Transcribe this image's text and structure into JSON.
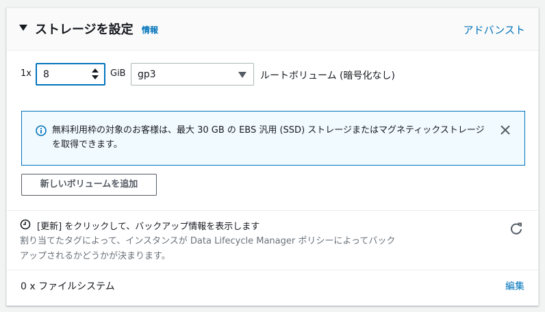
{
  "header": {
    "title": "ストレージを設定",
    "info_link": "情報",
    "advanced_link": "アドバンスト"
  },
  "volume": {
    "quantity_label": "1x",
    "size_value": "8",
    "size_unit": "GiB",
    "volume_type": "gp3",
    "root_label": "ルートボリューム (暗号化なし)"
  },
  "alert": {
    "text": "無料利用枠の対象のお客様は、最大 30 GB の EBS 汎用 (SSD) ストレージまたはマグネティックストレージを取得できます。"
  },
  "add_volume_button": "新しいボリュームを追加",
  "refresh_notice": {
    "title": "[更新] をクリックして、バックアップ情報を表示します",
    "description": "割り当てたタグによって、インスタンスが Data Lifecycle Manager ポリシーによってバックアップされるかどうかが決まります。"
  },
  "file_systems": {
    "label": "0 x ファイルシステム",
    "edit_link": "編集"
  },
  "colors": {
    "link": "#0073bb",
    "alert_background": "#f1faff",
    "alert_border": "#0073bb",
    "secondary_text": "#687078"
  },
  "icons": {
    "caret": "caret-down-icon",
    "alert": "info-icon",
    "close": "close-icon",
    "clock": "clock-icon",
    "refresh": "refresh-icon",
    "spinner": "spinner-icon",
    "select_arrow": "select-arrow-icon"
  }
}
